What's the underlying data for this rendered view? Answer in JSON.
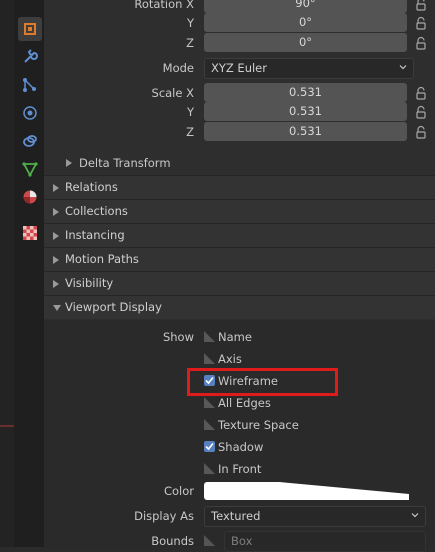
{
  "transform": {
    "rotation": {
      "label_x": "Rotation X",
      "label_y": "Y",
      "label_z": "Z",
      "x": "90°",
      "y": "0°",
      "z": "0°"
    },
    "mode": {
      "label": "Mode",
      "value": "XYZ Euler"
    },
    "scale": {
      "label_x": "Scale X",
      "label_y": "Y",
      "label_z": "Z",
      "x": "0.531",
      "y": "0.531",
      "z": "0.531"
    },
    "delta_transform": "Delta Transform"
  },
  "sections": {
    "relations": "Relations",
    "collections": "Collections",
    "instancing": "Instancing",
    "motion_paths": "Motion Paths",
    "visibility": "Visibility",
    "viewport_display": "Viewport Display"
  },
  "viewport_display": {
    "show_label": "Show",
    "options": [
      {
        "label": "Name",
        "checked": false
      },
      {
        "label": "Axis",
        "checked": false
      },
      {
        "label": "Wireframe",
        "checked": true
      },
      {
        "label": "All Edges",
        "checked": false
      },
      {
        "label": "Texture Space",
        "checked": false
      },
      {
        "label": "Shadow",
        "checked": true
      },
      {
        "label": "In Front",
        "checked": false
      }
    ],
    "color_label": "Color",
    "color_value": "#ffffff",
    "display_as_label": "Display As",
    "display_as_value": "Textured",
    "bounds_label": "Bounds",
    "bounds_value": "Box"
  },
  "icons": {
    "tabs": [
      "object-icon",
      "modifier-wrench-icon",
      "particles-icon",
      "physics-icon",
      "constraints-icon",
      "object-data-icon",
      "material-icon",
      "texture-icon"
    ]
  },
  "colors": {
    "highlight": "#e01b1b",
    "active_tab_icon": "#e07b2a",
    "checkbox": "#5680c2"
  }
}
